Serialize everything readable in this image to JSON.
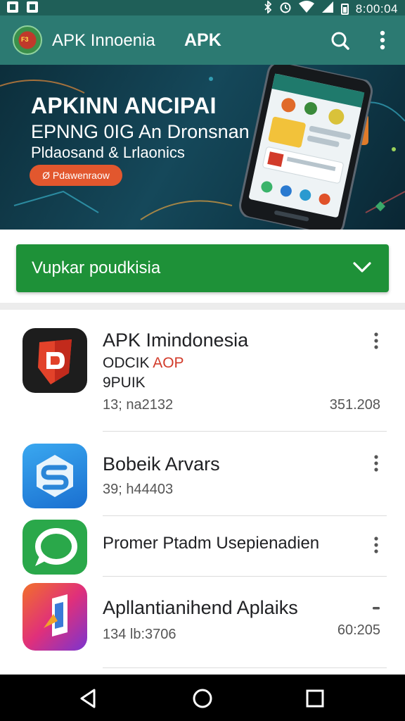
{
  "status_bar": {
    "time": "8:00:04"
  },
  "app_bar": {
    "logo_text": "F3",
    "title": "APK Innoenia",
    "subtitle": "APK"
  },
  "banner": {
    "title": "APKINN ANCIPAI",
    "line1": "EPNNG 0IG An Dronsnan",
    "line2": "Pldaosand & Lrlaonics",
    "button_label": "Ø Pdawenraow"
  },
  "dropdown": {
    "label": "Vupkar poudkisia"
  },
  "apps": [
    {
      "name": "APK Imindonesia",
      "line1_a": "ODCIK ",
      "line1_b": "AOP",
      "line2": "9PUIK",
      "meta": "13; na2132",
      "size": "351.208"
    },
    {
      "name": "Bobeik Arvars",
      "meta": "39; h44403"
    },
    {
      "name": "Promer Ptadm Usepienadien"
    },
    {
      "name": "Apllantianihend Aplaiks",
      "meta": "134 lb:3706",
      "size": "60:205"
    }
  ],
  "colors": {
    "app_bar": "#2c7a72",
    "status_bar": "#1f5f58",
    "dropdown": "#1e9138",
    "banner_button": "#e2572e",
    "accent_red": "#d23b2a"
  }
}
